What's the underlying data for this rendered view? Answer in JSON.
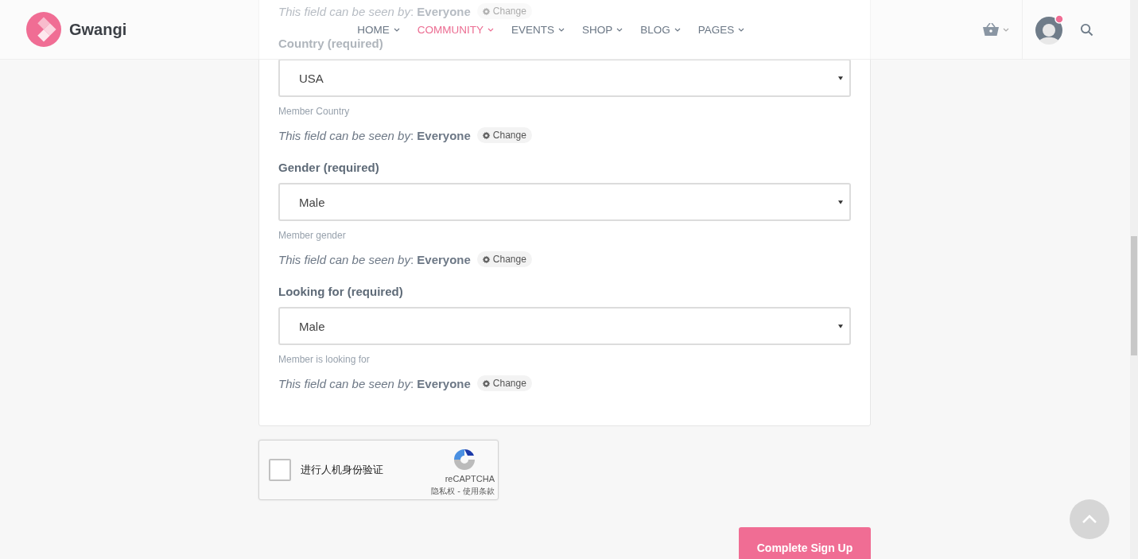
{
  "header": {
    "logo": "Gwangi",
    "nav": [
      {
        "label": "HOME",
        "selected": false
      },
      {
        "label": "COMMUNITY",
        "selected": true
      },
      {
        "label": "EVENTS",
        "selected": false
      },
      {
        "label": "SHOP",
        "selected": false
      },
      {
        "label": "BLOG",
        "selected": false
      },
      {
        "label": "PAGES",
        "selected": false
      }
    ],
    "notification": true
  },
  "form": {
    "previous_visibility": {
      "text": "*This field can be seen by*: **Everyone**",
      "button": "Change"
    },
    "fields": [
      {
        "label": "Country (required)",
        "value": "USA",
        "description": "Member Country",
        "visibility": "*This field can be seen by*: **Everyone**",
        "button": "Change"
      },
      {
        "label": "Gender (required)",
        "value": "Male",
        "description": "Member gender",
        "visibility": "*This field can be seen by*: **Everyone**",
        "button": "Change"
      },
      {
        "label": "Looking for (required)",
        "value": "Male",
        "description": "Member is looking for",
        "visibility": "*This field can be seen by*: **Everyone**",
        "button": "Change"
      }
    ]
  },
  "captcha": {
    "checked": false,
    "label": "进行人机身份验证",
    "brand": "reCAPTCHA",
    "links": "隐私权 - 使用条款"
  },
  "submit": "Complete Sign Up"
}
